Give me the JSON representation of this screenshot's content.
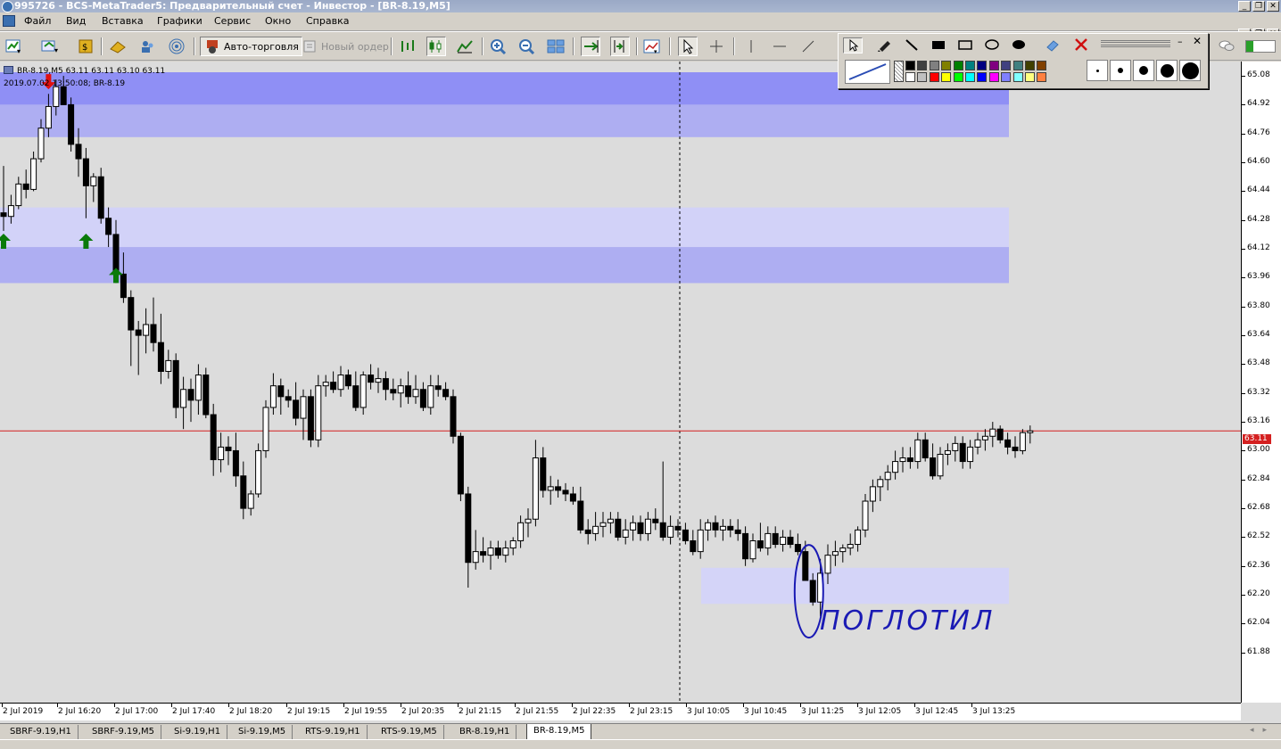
{
  "window": {
    "title": "995726 - BCS-MetaTrader5: Предварительный счет - Инвестор - [BR-8.19,M5]"
  },
  "menu": [
    "Файл",
    "Вид",
    "Вставка",
    "Графики",
    "Сервис",
    "Окно",
    "Справка"
  ],
  "toolbar": {
    "autotrade_label": "Авто-торговля",
    "new_order_label": "Новый ордер"
  },
  "chart": {
    "header_line1": "BR-8.19,M5  63.11 63.11 63.10 63.11",
    "header_line2": "2019.07.02 13:50:08; BR-8.19",
    "current_price": "63.11",
    "annotation": "поглотил",
    "y_labels": [
      "65.08",
      "64.92",
      "64.76",
      "64.60",
      "64.44",
      "64.28",
      "64.12",
      "63.96",
      "63.80",
      "63.64",
      "63.48",
      "63.32",
      "63.16",
      "63.00",
      "62.84",
      "62.68",
      "62.52",
      "62.36",
      "62.20",
      "62.04",
      "61.88"
    ],
    "x_labels": [
      "2 Jul 2019",
      "2 Jul 16:20",
      "2 Jul 17:00",
      "2 Jul 17:40",
      "2 Jul 18:20",
      "2 Jul 19:15",
      "2 Jul 19:55",
      "2 Jul 20:35",
      "2 Jul 21:15",
      "2 Jul 21:55",
      "2 Jul 22:35",
      "2 Jul 23:15",
      "3 Jul 10:05",
      "3 Jul 10:45",
      "3 Jul 11:25",
      "3 Jul 12:05",
      "3 Jul 12:45",
      "3 Jul 13:25"
    ]
  },
  "chart_data": {
    "type": "candlestick",
    "symbol": "BR-8.19",
    "timeframe": "M5",
    "ylim": [
      61.78,
      65.12
    ],
    "current_price": 63.11,
    "price_line": 63.11,
    "zones": [
      {
        "from": 64.92,
        "to": 65.1,
        "color": "#8f8ff5"
      },
      {
        "from": 64.74,
        "to": 64.92,
        "color": "#aeaef2"
      },
      {
        "from": 64.13,
        "to": 64.35,
        "color": "#d2d2f8"
      },
      {
        "from": 63.93,
        "to": 64.13,
        "color": "#aeaef2"
      },
      {
        "from": 62.15,
        "to": 62.35,
        "color": "#d4d4f8"
      }
    ],
    "arrows": [
      {
        "dir": "down",
        "index": 6,
        "price": 65.05
      },
      {
        "dir": "up",
        "index": 0,
        "price": 64.16
      },
      {
        "dir": "up",
        "index": 11,
        "price": 64.16
      },
      {
        "dir": "up",
        "index": 15,
        "price": 63.97
      }
    ],
    "ohlc": [
      [
        64.32,
        64.58,
        64.22,
        64.3
      ],
      [
        64.3,
        64.42,
        64.26,
        64.36
      ],
      [
        64.36,
        64.52,
        64.34,
        64.48
      ],
      [
        64.48,
        64.56,
        64.4,
        64.45
      ],
      [
        64.45,
        64.66,
        64.44,
        64.62
      ],
      [
        64.62,
        64.84,
        64.6,
        64.79
      ],
      [
        64.79,
        64.98,
        64.74,
        64.91
      ],
      [
        64.91,
        65.06,
        64.86,
        65.02
      ],
      [
        65.02,
        65.08,
        64.96,
        64.92
      ],
      [
        64.92,
        64.96,
        64.66,
        64.7
      ],
      [
        64.7,
        64.79,
        64.52,
        64.62
      ],
      [
        64.62,
        64.68,
        64.29,
        64.47
      ],
      [
        64.47,
        64.54,
        64.38,
        64.52
      ],
      [
        64.52,
        64.57,
        64.26,
        64.29
      ],
      [
        64.29,
        64.35,
        64.13,
        64.2
      ],
      [
        64.2,
        64.28,
        63.93,
        63.98
      ],
      [
        63.98,
        64.1,
        63.82,
        63.85
      ],
      [
        63.85,
        63.89,
        63.47,
        63.67
      ],
      [
        63.67,
        63.72,
        63.42,
        63.64
      ],
      [
        63.64,
        63.79,
        63.54,
        63.7
      ],
      [
        63.7,
        63.85,
        63.55,
        63.6
      ],
      [
        63.6,
        63.76,
        63.37,
        63.44
      ],
      [
        63.44,
        63.56,
        63.4,
        63.5
      ],
      [
        63.5,
        63.54,
        63.18,
        63.24
      ],
      [
        63.24,
        63.41,
        63.12,
        63.34
      ],
      [
        63.34,
        63.4,
        63.16,
        63.28
      ],
      [
        63.28,
        63.48,
        63.2,
        63.42
      ],
      [
        63.42,
        63.46,
        63.18,
        63.2
      ],
      [
        63.2,
        63.26,
        62.86,
        62.95
      ],
      [
        62.95,
        63.1,
        62.88,
        63.02
      ],
      [
        63.02,
        63.08,
        62.92,
        63.0
      ],
      [
        63.0,
        63.1,
        62.8,
        62.86
      ],
      [
        62.86,
        62.94,
        62.62,
        62.68
      ],
      [
        62.68,
        62.78,
        62.64,
        62.76
      ],
      [
        62.76,
        63.04,
        62.74,
        63.0
      ],
      [
        63.0,
        63.28,
        62.96,
        63.24
      ],
      [
        63.24,
        63.43,
        63.2,
        63.36
      ],
      [
        63.36,
        63.4,
        63.2,
        63.3
      ],
      [
        63.3,
        63.34,
        63.24,
        63.28
      ],
      [
        63.28,
        63.38,
        63.14,
        63.18
      ],
      [
        63.18,
        63.34,
        63.06,
        63.3
      ],
      [
        63.3,
        63.34,
        63.02,
        63.06
      ],
      [
        63.06,
        63.42,
        63.02,
        63.36
      ],
      [
        63.36,
        63.42,
        63.3,
        63.38
      ],
      [
        63.38,
        63.44,
        63.32,
        63.34
      ],
      [
        63.34,
        63.47,
        63.3,
        63.42
      ],
      [
        63.42,
        63.45,
        63.34,
        63.36
      ],
      [
        63.36,
        63.44,
        63.22,
        63.24
      ],
      [
        63.24,
        63.44,
        63.2,
        63.42
      ],
      [
        63.42,
        63.48,
        63.34,
        63.38
      ],
      [
        63.38,
        63.46,
        63.32,
        63.4
      ],
      [
        63.4,
        63.44,
        63.28,
        63.34
      ],
      [
        63.34,
        63.4,
        63.28,
        63.32
      ],
      [
        63.32,
        63.4,
        63.24,
        63.36
      ],
      [
        63.36,
        63.44,
        63.26,
        63.3
      ],
      [
        63.3,
        63.42,
        63.26,
        63.34
      ],
      [
        63.34,
        63.38,
        63.22,
        63.24
      ],
      [
        63.24,
        63.42,
        63.2,
        63.36
      ],
      [
        63.36,
        63.42,
        63.3,
        63.34
      ],
      [
        63.34,
        63.38,
        63.28,
        63.3
      ],
      [
        63.3,
        63.34,
        63.04,
        63.08
      ],
      [
        63.08,
        63.1,
        62.72,
        62.76
      ],
      [
        62.76,
        62.8,
        62.24,
        62.38
      ],
      [
        62.38,
        62.56,
        62.34,
        62.44
      ],
      [
        62.44,
        62.52,
        62.38,
        62.42
      ],
      [
        62.42,
        62.5,
        62.34,
        62.46
      ],
      [
        62.46,
        62.5,
        62.4,
        62.42
      ],
      [
        62.42,
        62.5,
        62.38,
        62.46
      ],
      [
        62.46,
        62.52,
        62.42,
        62.5
      ],
      [
        62.5,
        62.64,
        62.46,
        62.6
      ],
      [
        62.6,
        62.68,
        62.52,
        62.62
      ],
      [
        62.62,
        63.06,
        62.58,
        62.96
      ],
      [
        62.96,
        63.02,
        62.74,
        62.78
      ],
      [
        62.78,
        62.86,
        62.7,
        62.8
      ],
      [
        62.8,
        62.84,
        62.74,
        62.78
      ],
      [
        62.78,
        62.82,
        62.72,
        62.76
      ],
      [
        62.76,
        62.8,
        62.7,
        62.72
      ],
      [
        62.72,
        62.8,
        62.54,
        62.56
      ],
      [
        62.56,
        62.62,
        62.48,
        62.54
      ],
      [
        62.54,
        62.66,
        62.5,
        62.58
      ],
      [
        62.58,
        62.66,
        62.52,
        62.6
      ],
      [
        62.6,
        62.66,
        62.54,
        62.62
      ],
      [
        62.62,
        62.66,
        62.5,
        62.52
      ],
      [
        62.52,
        62.62,
        62.48,
        62.56
      ],
      [
        62.56,
        62.64,
        62.5,
        62.6
      ],
      [
        62.6,
        62.64,
        62.5,
        62.54
      ],
      [
        62.54,
        62.66,
        62.5,
        62.62
      ],
      [
        62.62,
        62.68,
        62.56,
        62.6
      ],
      [
        62.6,
        62.94,
        62.5,
        62.52
      ],
      [
        62.52,
        62.64,
        62.48,
        62.58
      ],
      [
        62.58,
        62.62,
        62.52,
        62.56
      ],
      [
        62.56,
        62.6,
        62.48,
        62.5
      ],
      [
        62.5,
        62.56,
        62.42,
        62.44
      ],
      [
        62.44,
        62.62,
        62.4,
        62.56
      ],
      [
        62.56,
        62.62,
        62.5,
        62.6
      ],
      [
        62.6,
        62.64,
        62.52,
        62.56
      ],
      [
        62.56,
        62.62,
        62.5,
        62.58
      ],
      [
        62.58,
        62.62,
        62.52,
        62.56
      ],
      [
        62.56,
        62.62,
        62.5,
        62.54
      ],
      [
        62.54,
        62.58,
        62.36,
        62.4
      ],
      [
        62.4,
        62.54,
        62.38,
        62.5
      ],
      [
        62.5,
        62.6,
        62.44,
        62.46
      ],
      [
        62.46,
        62.58,
        62.42,
        62.54
      ],
      [
        62.54,
        62.58,
        62.46,
        62.48
      ],
      [
        62.48,
        62.56,
        62.44,
        62.52
      ],
      [
        62.52,
        62.56,
        62.46,
        62.48
      ],
      [
        62.48,
        62.54,
        62.42,
        62.44
      ],
      [
        62.44,
        62.5,
        62.3,
        62.28
      ],
      [
        62.28,
        62.32,
        62.14,
        62.16
      ],
      [
        62.16,
        62.4,
        62.08,
        62.32
      ],
      [
        62.32,
        62.48,
        62.26,
        62.42
      ],
      [
        62.42,
        62.5,
        62.36,
        62.44
      ],
      [
        62.44,
        62.48,
        62.38,
        62.46
      ],
      [
        62.46,
        62.54,
        62.42,
        62.48
      ],
      [
        62.48,
        62.58,
        62.44,
        62.56
      ],
      [
        62.56,
        62.76,
        62.52,
        62.72
      ],
      [
        62.72,
        62.84,
        62.66,
        62.8
      ],
      [
        62.8,
        62.86,
        62.72,
        62.84
      ],
      [
        62.84,
        62.92,
        62.78,
        62.88
      ],
      [
        62.88,
        63.0,
        62.84,
        62.94
      ],
      [
        62.94,
        63.02,
        62.88,
        62.96
      ],
      [
        62.96,
        63.02,
        62.9,
        62.94
      ],
      [
        62.94,
        63.1,
        62.9,
        63.06
      ],
      [
        63.06,
        63.1,
        62.94,
        62.96
      ],
      [
        62.96,
        63.04,
        62.84,
        62.86
      ],
      [
        62.86,
        63.02,
        62.84,
        62.98
      ],
      [
        62.98,
        63.04,
        62.92,
        63.0
      ],
      [
        63.0,
        63.08,
        62.94,
        63.04
      ],
      [
        63.04,
        63.08,
        62.9,
        62.94
      ],
      [
        62.94,
        63.06,
        62.9,
        63.02
      ],
      [
        63.02,
        63.1,
        62.98,
        63.06
      ],
      [
        63.06,
        63.12,
        63.0,
        63.08
      ],
      [
        63.08,
        63.16,
        63.02,
        63.12
      ],
      [
        63.12,
        63.14,
        63.04,
        63.06
      ],
      [
        63.06,
        63.1,
        62.98,
        63.02
      ],
      [
        63.02,
        63.08,
        62.96,
        63.0
      ],
      [
        63.0,
        63.12,
        62.98,
        63.1
      ],
      [
        63.1,
        63.14,
        63.04,
        63.11
      ]
    ]
  },
  "tabs": [
    "SBRF-9.19,H1",
    "SBRF-9.19,M5",
    "Si-9.19,H1",
    "Si-9.19,M5",
    "RTS-9.19,H1",
    "RTS-9.19,M5",
    "BR-8.19,H1",
    "BR-8.19,M5"
  ],
  "active_tab": "BR-8.19,M5",
  "colors": {
    "chart_bg": "#dcdcdc",
    "price_line": "#d42020",
    "annotation": "#1a1ab4",
    "arrow_up": "#0a7a0a",
    "arrow_down": "#e01010",
    "candle": "#000000"
  },
  "palette": [
    "#000000",
    "#404040",
    "#808080",
    "#808000",
    "#008000",
    "#008080",
    "#000080",
    "#800080",
    "#404080",
    "#408080",
    "#404000",
    "#804000",
    "#ffffff",
    "#c0c0c0",
    "#ff0000",
    "#ffff00",
    "#00ff00",
    "#00ffff",
    "#0000ff",
    "#ff00ff",
    "#8080ff",
    "#80ffff",
    "#ffff80",
    "#ff8040"
  ]
}
